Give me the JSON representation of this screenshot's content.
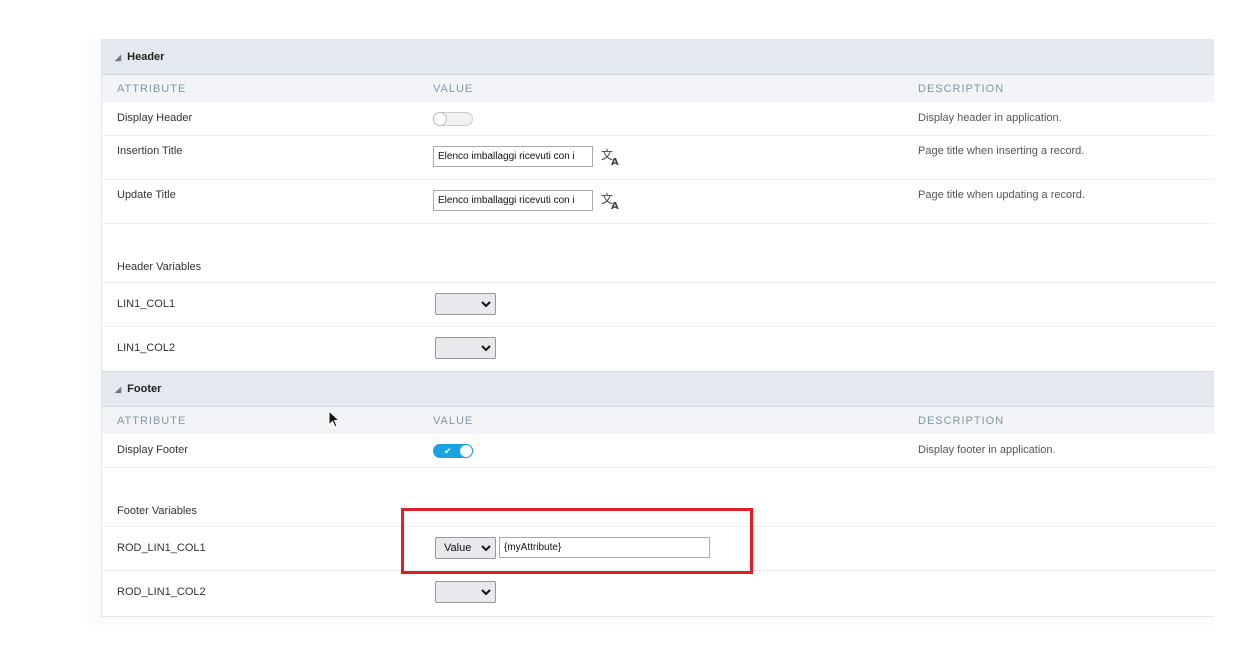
{
  "header_section": {
    "title": "Header",
    "col_attribute": "ATTRIBUTE",
    "col_value": "VALUE",
    "col_description": "DESCRIPTION",
    "display_header": {
      "label": "Display Header",
      "enabled": false,
      "description": "Display header in application."
    },
    "insertion_title": {
      "label": "Insertion Title",
      "value": "Elenco imballaggi ricevuti con i",
      "description": "Page title when inserting a record."
    },
    "update_title": {
      "label": "Update Title",
      "value": "Elenco imballaggi ricevuti con i",
      "description": "Page title when updating a record."
    },
    "variables_label": "Header Variables",
    "lin1_col1": {
      "label": "LIN1_COL1",
      "selected": ""
    },
    "lin1_col2": {
      "label": "LIN1_COL2",
      "selected": ""
    }
  },
  "footer_section": {
    "title": "Footer",
    "col_attribute": "ATTRIBUTE",
    "col_value": "VALUE",
    "col_description": "DESCRIPTION",
    "display_footer": {
      "label": "Display Footer",
      "enabled": true,
      "description": "Display footer in application."
    },
    "variables_label": "Footer Variables",
    "rod_lin1_col1": {
      "label": "ROD_LIN1_COL1",
      "selected": "Value",
      "value": "{myAttribute}"
    },
    "rod_lin1_col2": {
      "label": "ROD_LIN1_COL2",
      "selected": ""
    }
  },
  "colors": {
    "accent": "#1aa1e0",
    "highlight": "#e01e2a",
    "section_bg": "#e4e9ef",
    "column_header_text": "#7e98a6"
  },
  "icons": {
    "collapse": "triangle-collapse-icon",
    "translate": "translate-icon",
    "chevron": "chevron-down-icon",
    "cursor": "mouse-pointer-icon"
  }
}
